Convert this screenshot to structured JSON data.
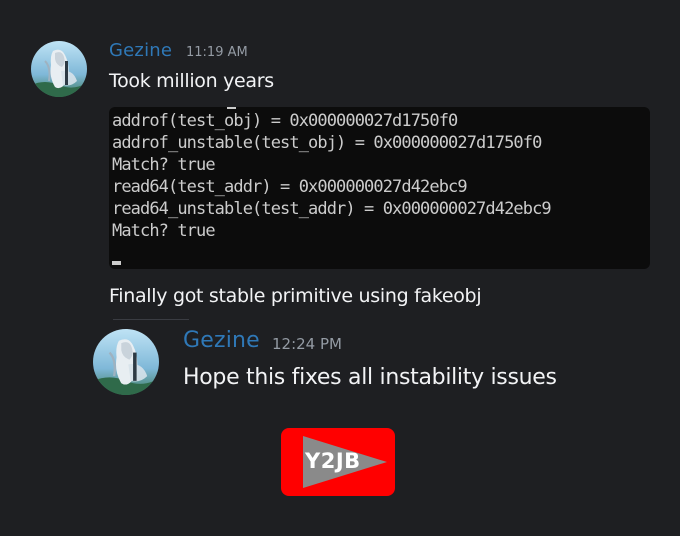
{
  "messages": [
    {
      "username": "Gezine",
      "timestamp": "11:19 AM",
      "text": "Took million years",
      "attachment": {
        "type": "terminal-screenshot",
        "lines": [
          "addrof(test_obj) = 0x000000027d1750f0",
          "addrof_unstable(test_obj) = 0x000000027d1750f0",
          "Match? true",
          "read64(test_addr) = 0x000000027d42ebc9",
          "read64_unstable(test_addr) = 0x000000027d42ebc9",
          "Match? true"
        ]
      },
      "followup_text": "Finally got stable primitive using fakeobj"
    },
    {
      "username": "Gezine",
      "timestamp": "12:24 PM",
      "text": "Hope this fixes all instability issues"
    }
  ],
  "badge": {
    "label": "Y2JB",
    "color": "#ff0000"
  },
  "colors": {
    "background": "#1e1f22",
    "username": "#2f78b7",
    "timestamp": "#949ba4",
    "message_text": "#f2f3f5",
    "terminal_bg": "#0c0c0c",
    "terminal_text": "#cccccc"
  },
  "icons": {
    "avatar": "anime-character-avatar"
  }
}
